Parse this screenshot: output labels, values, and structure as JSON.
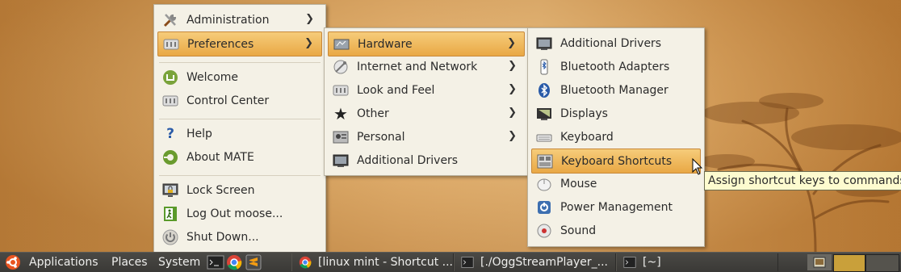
{
  "menus": {
    "system": [
      {
        "label": "Administration",
        "icon": "administration-icon",
        "submenu": true
      },
      {
        "label": "Preferences",
        "icon": "preferences-icon",
        "submenu": true,
        "highlighted": true
      },
      {
        "label": "Welcome",
        "icon": "mint-logo-icon"
      },
      {
        "label": "Control Center",
        "icon": "control-center-icon"
      },
      {
        "label": "Help",
        "icon": "help-icon"
      },
      {
        "label": "About MATE",
        "icon": "mate-logo-icon"
      },
      {
        "label": "Lock Screen",
        "icon": "lock-screen-icon"
      },
      {
        "label": "Log Out moose...",
        "icon": "log-out-icon"
      },
      {
        "label": "Shut Down...",
        "icon": "power-icon"
      }
    ],
    "preferences": [
      {
        "label": "Hardware",
        "icon": "hardware-icon",
        "submenu": true,
        "highlighted": true
      },
      {
        "label": "Internet and Network",
        "icon": "network-icon",
        "submenu": true
      },
      {
        "label": "Look and Feel",
        "icon": "look-and-feel-icon",
        "submenu": true
      },
      {
        "label": "Other",
        "icon": "star-icon",
        "submenu": true
      },
      {
        "label": "Personal",
        "icon": "personal-icon",
        "submenu": true
      },
      {
        "label": "Additional Drivers",
        "icon": "drivers-icon"
      }
    ],
    "hardware": [
      {
        "label": "Additional Drivers",
        "icon": "drivers-icon"
      },
      {
        "label": "Bluetooth Adapters",
        "icon": "bluetooth-adapter-icon"
      },
      {
        "label": "Bluetooth Manager",
        "icon": "bluetooth-icon"
      },
      {
        "label": "Displays",
        "icon": "display-icon"
      },
      {
        "label": "Keyboard",
        "icon": "keyboard-icon"
      },
      {
        "label": "Keyboard Shortcuts",
        "icon": "keyboard-shortcuts-icon",
        "highlighted": true
      },
      {
        "label": "Mouse",
        "icon": "mouse-icon"
      },
      {
        "label": "Power Management",
        "icon": "power-management-icon"
      },
      {
        "label": "Sound",
        "icon": "sound-icon"
      }
    ]
  },
  "tooltip": "Assign shortcut keys to commands",
  "panel": {
    "applications": "Applications",
    "places": "Places",
    "system": "System",
    "tasks": [
      {
        "label": "[linux mint - Shortcut ...",
        "icon": "chromium-icon"
      },
      {
        "label": "[./OggStreamPlayer_...",
        "icon": "terminal-icon"
      },
      {
        "label": "[~]",
        "icon": "terminal-icon"
      }
    ]
  },
  "colors": {
    "highlight": "#eeb45a",
    "menu_bg": "#f4f1e6",
    "panel_bg": "#3f3e3a"
  }
}
